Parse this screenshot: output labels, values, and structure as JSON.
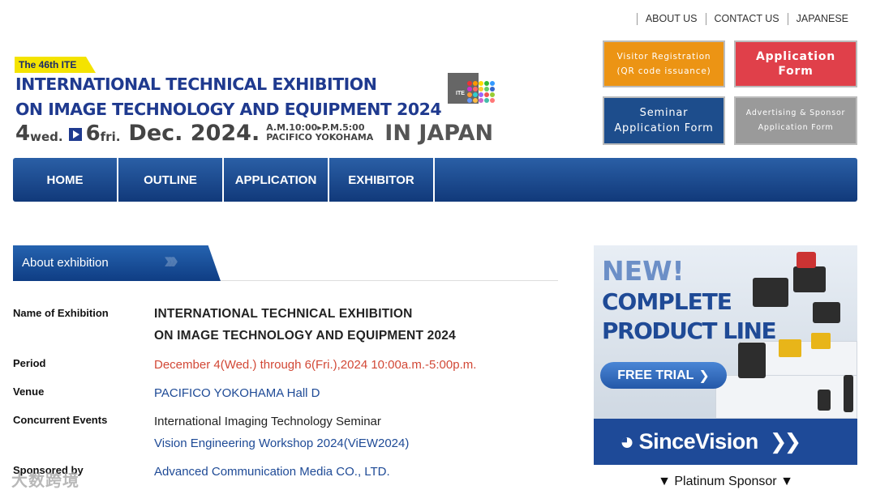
{
  "top_links": [
    "ABOUT US",
    "CONTACT US",
    "JAPANESE"
  ],
  "banner": {
    "badge": "The 46th ITE",
    "title_line1": "INTERNATIONAL TECHNICAL EXHIBITION",
    "title_line2": "ON IMAGE TECHNOLOGY AND EQUIPMENT 2024",
    "day_start": "4",
    "day_start_week": "wed.",
    "day_end": "6",
    "day_end_week": "fri.",
    "month_year": "Dec. 2024.",
    "time": "A.M.10:00▸P.M.5:00",
    "place": "PACIFICO YOKOHAMA",
    "country": "IN JAPAN",
    "logo_text": "ITE"
  },
  "buttons": {
    "visitor_line1": "Visitor Registration",
    "visitor_line2": "(QR code issuance)",
    "application_line1": "Application",
    "application_line2": "Form",
    "seminar_line1": "Seminar",
    "seminar_line2": "Application Form",
    "advertising_line1": "Advertising & Sponsor",
    "advertising_line2": "Application Form"
  },
  "nav": [
    "HOME",
    "OUTLINE",
    "APPLICATION",
    "EXHIBITOR"
  ],
  "section": {
    "title": "About exhibition"
  },
  "info": {
    "name_label": "Name of Exhibition",
    "name_line1": "INTERNATIONAL TECHNICAL EXHIBITION",
    "name_line2": "ON IMAGE TECHNOLOGY AND EQUIPMENT 2024",
    "period_label": "Period",
    "period_value": "December 4(Wed.) through 6(Fri.),2024 10:00a.m.-5:00p.m.",
    "venue_label": "Venue",
    "venue_value": "PACIFICO YOKOHAMA Hall D",
    "events_label": "Concurrent Events",
    "events_value1": "International Imaging Technology Seminar",
    "events_value2": "Vision Engineering Workshop 2024(ViEW2024)",
    "sponsored_label": "Sponsored by",
    "sponsored_value": "Advanced Communication Media CO., LTD."
  },
  "ad": {
    "new": "NEW!",
    "line1": "COMPLETE",
    "line2": "PRODUCT LINE",
    "trial": "FREE TRIAL",
    "brand": "SinceVision"
  },
  "sponsor_caption": "▼ Platinum Sponsor ▼",
  "watermark": "大数跨境",
  "colors": {
    "nav_blue": "#11397a",
    "visitor_orange": "#ec9414",
    "application_red": "#e0404a",
    "seminar_blue": "#1d4d8c",
    "advertising_grey": "#9a9a9a",
    "period_red": "#d24836",
    "link_blue": "#1e4a96"
  }
}
